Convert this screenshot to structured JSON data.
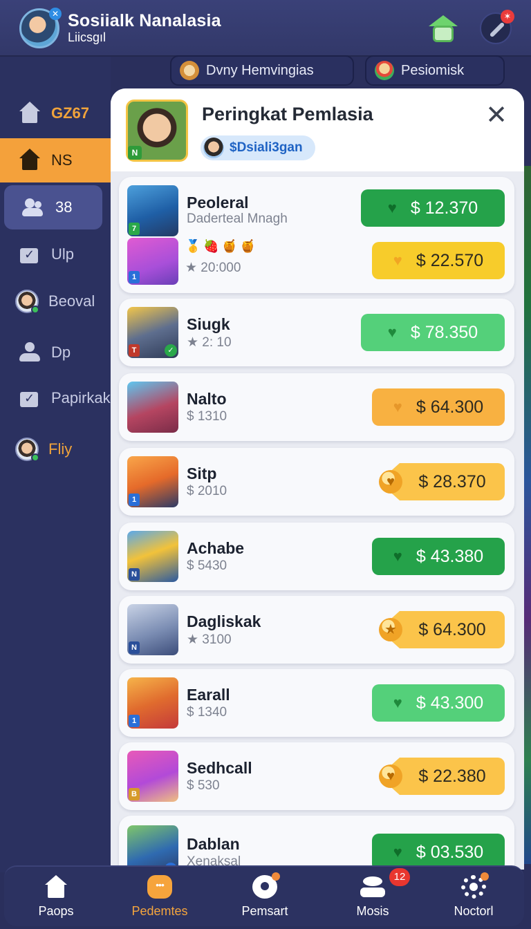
{
  "header": {
    "title": "Sosiialk Nanalasia",
    "subtitle": "Liicsgıl",
    "notification_badge": "✕",
    "tools_badge": "✶"
  },
  "sidebar": {
    "items": [
      {
        "label": "GZ67",
        "icon": "home-icon"
      },
      {
        "label": "NS",
        "icon": "home-icon"
      },
      {
        "label": "38",
        "icon": "people-icon"
      },
      {
        "label": "Ulp",
        "icon": "checkbox-icon"
      },
      {
        "label": "Beoval",
        "icon": "avatar-icon"
      },
      {
        "label": "Dp",
        "icon": "person-icon"
      },
      {
        "label": "Papirkak",
        "icon": "calendar-check-icon"
      },
      {
        "label": "Fliy",
        "icon": "avatar-icon"
      }
    ]
  },
  "top_tabs": [
    {
      "label": "Dvny Hemvingias"
    },
    {
      "label": "Pesiomisk"
    }
  ],
  "panel": {
    "title": "Peringkat Pemlasia",
    "chip_label": "$Dsiali3gan",
    "close_symbol": "✕"
  },
  "leaderboard": [
    {
      "name": "Peoleral",
      "sub": "Daderteal Mnagh",
      "prize": "$ 12.370",
      "prize_style": "green",
      "tag": "7"
    },
    {
      "name": "",
      "sub": "★ 20:000",
      "prize": "$ 22.570",
      "prize_style": "yellow",
      "tag": "1"
    },
    {
      "name": "Siugk",
      "sub": "★ 2: 10",
      "prize": "$ 78.350",
      "prize_style": "lightgreen",
      "tag": "T"
    },
    {
      "name": "Nalto",
      "sub": "$ 1310",
      "prize": "$ 64.300",
      "prize_style": "orange",
      "tag": ""
    },
    {
      "name": "Sitp",
      "sub": "$ 2010",
      "prize": "$ 28.370",
      "prize_style": "tag",
      "tag": "1"
    },
    {
      "name": "Achabe",
      "sub": "$ 5430",
      "prize": "$ 43.380",
      "prize_style": "green",
      "tag": "N"
    },
    {
      "name": "Dagliskak",
      "sub": "★ 3100",
      "prize": "$ 64.300",
      "prize_style": "tag",
      "tag": "N"
    },
    {
      "name": "Earall",
      "sub": "$ 1340",
      "prize": "$ 43.300",
      "prize_style": "lightgreen",
      "tag": "1"
    },
    {
      "name": "Sedhcall",
      "sub": "$ 530",
      "prize": "$ 22.380",
      "prize_style": "tag",
      "tag": "B"
    },
    {
      "name": "Dablan",
      "sub": "Xenaksal",
      "prize": "$ 03.530",
      "prize_style": "green",
      "tag": "1"
    }
  ],
  "bottom_nav": [
    {
      "label": "Paops",
      "icon": "home-icon"
    },
    {
      "label": "Pedemtes",
      "icon": "chat-icon"
    },
    {
      "label": "Pemsart",
      "icon": "clock-icon"
    },
    {
      "label": "Mosis",
      "icon": "stack-icon",
      "badge": "12"
    },
    {
      "label": "Noctorl",
      "icon": "gear-icon"
    }
  ],
  "colors": {
    "accent": "#f4a13b",
    "sidebar_bg": "#2b3160",
    "prize_green": "#25a24a",
    "prize_yellow": "#f7cc2b"
  }
}
